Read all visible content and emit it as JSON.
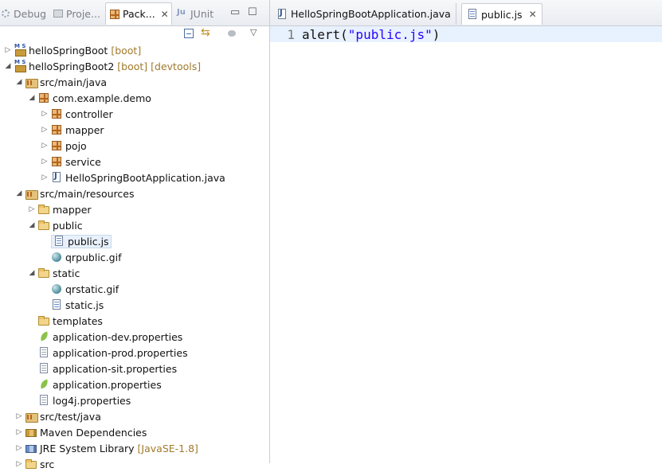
{
  "left_panel": {
    "tabs": [
      {
        "label": "Debug",
        "icon": "debug-icon"
      },
      {
        "label": "Proje...",
        "icon": "project-explorer-icon"
      },
      {
        "label": "Pack...",
        "icon": "package-explorer-icon"
      },
      {
        "label": "JUnit",
        "icon": "junit-icon"
      }
    ],
    "active_tab_close": "✕",
    "minimize": "▭",
    "maximize": "☐",
    "tree": [
      {
        "label": "helloSpringBoot",
        "deco": "[boot]"
      },
      {
        "label": "helloSpringBoot2",
        "deco": "[boot] [devtools]"
      },
      {
        "label": "src/main/java",
        "deco": ""
      },
      {
        "label": "com.example.demo",
        "deco": ""
      },
      {
        "label": "controller",
        "deco": ""
      },
      {
        "label": "mapper",
        "deco": ""
      },
      {
        "label": "pojo",
        "deco": ""
      },
      {
        "label": "service",
        "deco": ""
      },
      {
        "label": "HelloSpringBootApplication.java",
        "deco": ""
      },
      {
        "label": "src/main/resources",
        "deco": ""
      },
      {
        "label": "mapper",
        "deco": ""
      },
      {
        "label": "public",
        "deco": ""
      },
      {
        "label": "public.js",
        "deco": ""
      },
      {
        "label": "qrpublic.gif",
        "deco": ""
      },
      {
        "label": "static",
        "deco": ""
      },
      {
        "label": "qrstatic.gif",
        "deco": ""
      },
      {
        "label": "static.js",
        "deco": ""
      },
      {
        "label": "templates",
        "deco": ""
      },
      {
        "label": "application-dev.properties",
        "deco": ""
      },
      {
        "label": "application-prod.properties",
        "deco": ""
      },
      {
        "label": "application-sit.properties",
        "deco": ""
      },
      {
        "label": "application.properties",
        "deco": ""
      },
      {
        "label": "log4j.properties",
        "deco": ""
      },
      {
        "label": "src/test/java",
        "deco": ""
      },
      {
        "label": "Maven Dependencies",
        "deco": ""
      },
      {
        "label": "JRE System Library",
        "deco": "[JavaSE-1.8]"
      },
      {
        "label": "src",
        "deco": ""
      }
    ]
  },
  "editor": {
    "tabs": [
      {
        "label": "HelloSpringBootApplication.java",
        "icon": "java-file-icon"
      },
      {
        "label": "public.js",
        "icon": "js-file-icon"
      }
    ],
    "close_glyph": "✕",
    "code": {
      "line_number": "1",
      "code_prefix": "alert(",
      "code_string": "\"public.js\"",
      "code_suffix": ")"
    }
  },
  "colors": {
    "string_literal": "#2a00ff",
    "decoration": "#a07a2c",
    "current_line": "#e8f2fe"
  }
}
